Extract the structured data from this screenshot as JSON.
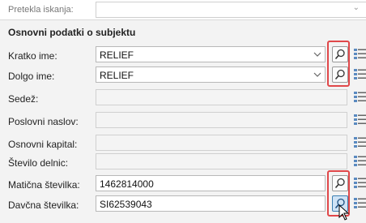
{
  "header": {
    "label": "Pretekla iskanja:",
    "value": ""
  },
  "section": {
    "title": "Osnovni podatki o subjektu"
  },
  "fields": [
    {
      "label": "Kratko ime:",
      "value": "RELIEF",
      "dropdown": true,
      "search_button": true,
      "enabled": true
    },
    {
      "label": "Dolgo ime:",
      "value": "RELIEF",
      "dropdown": true,
      "search_button": true,
      "enabled": true
    },
    {
      "label": "Sedež:",
      "value": "",
      "dropdown": false,
      "search_button": false,
      "enabled": false
    },
    {
      "label": "Poslovni naslov:",
      "value": "",
      "dropdown": false,
      "search_button": false,
      "enabled": false
    },
    {
      "label": "Osnovni kapital:",
      "value": "",
      "dropdown": false,
      "search_button": false,
      "enabled": false
    },
    {
      "label": "Število delnic:",
      "value": "",
      "dropdown": false,
      "search_button": false,
      "enabled": false
    },
    {
      "label": "Matična številka:",
      "value": "1462814000",
      "dropdown": false,
      "search_button": true,
      "enabled": true
    },
    {
      "label": "Davčna številka:",
      "value": "SI62539043",
      "dropdown": false,
      "search_button": true,
      "enabled": true,
      "search_active": true
    }
  ],
  "icons": {
    "search": "magnifier-icon",
    "list": "list-details-icon",
    "dropdown": "chevron-down-icon",
    "cursor": "mouse-pointer-icon"
  },
  "colors": {
    "highlight": "#e0484a",
    "active_button": "#cfe3f6"
  }
}
